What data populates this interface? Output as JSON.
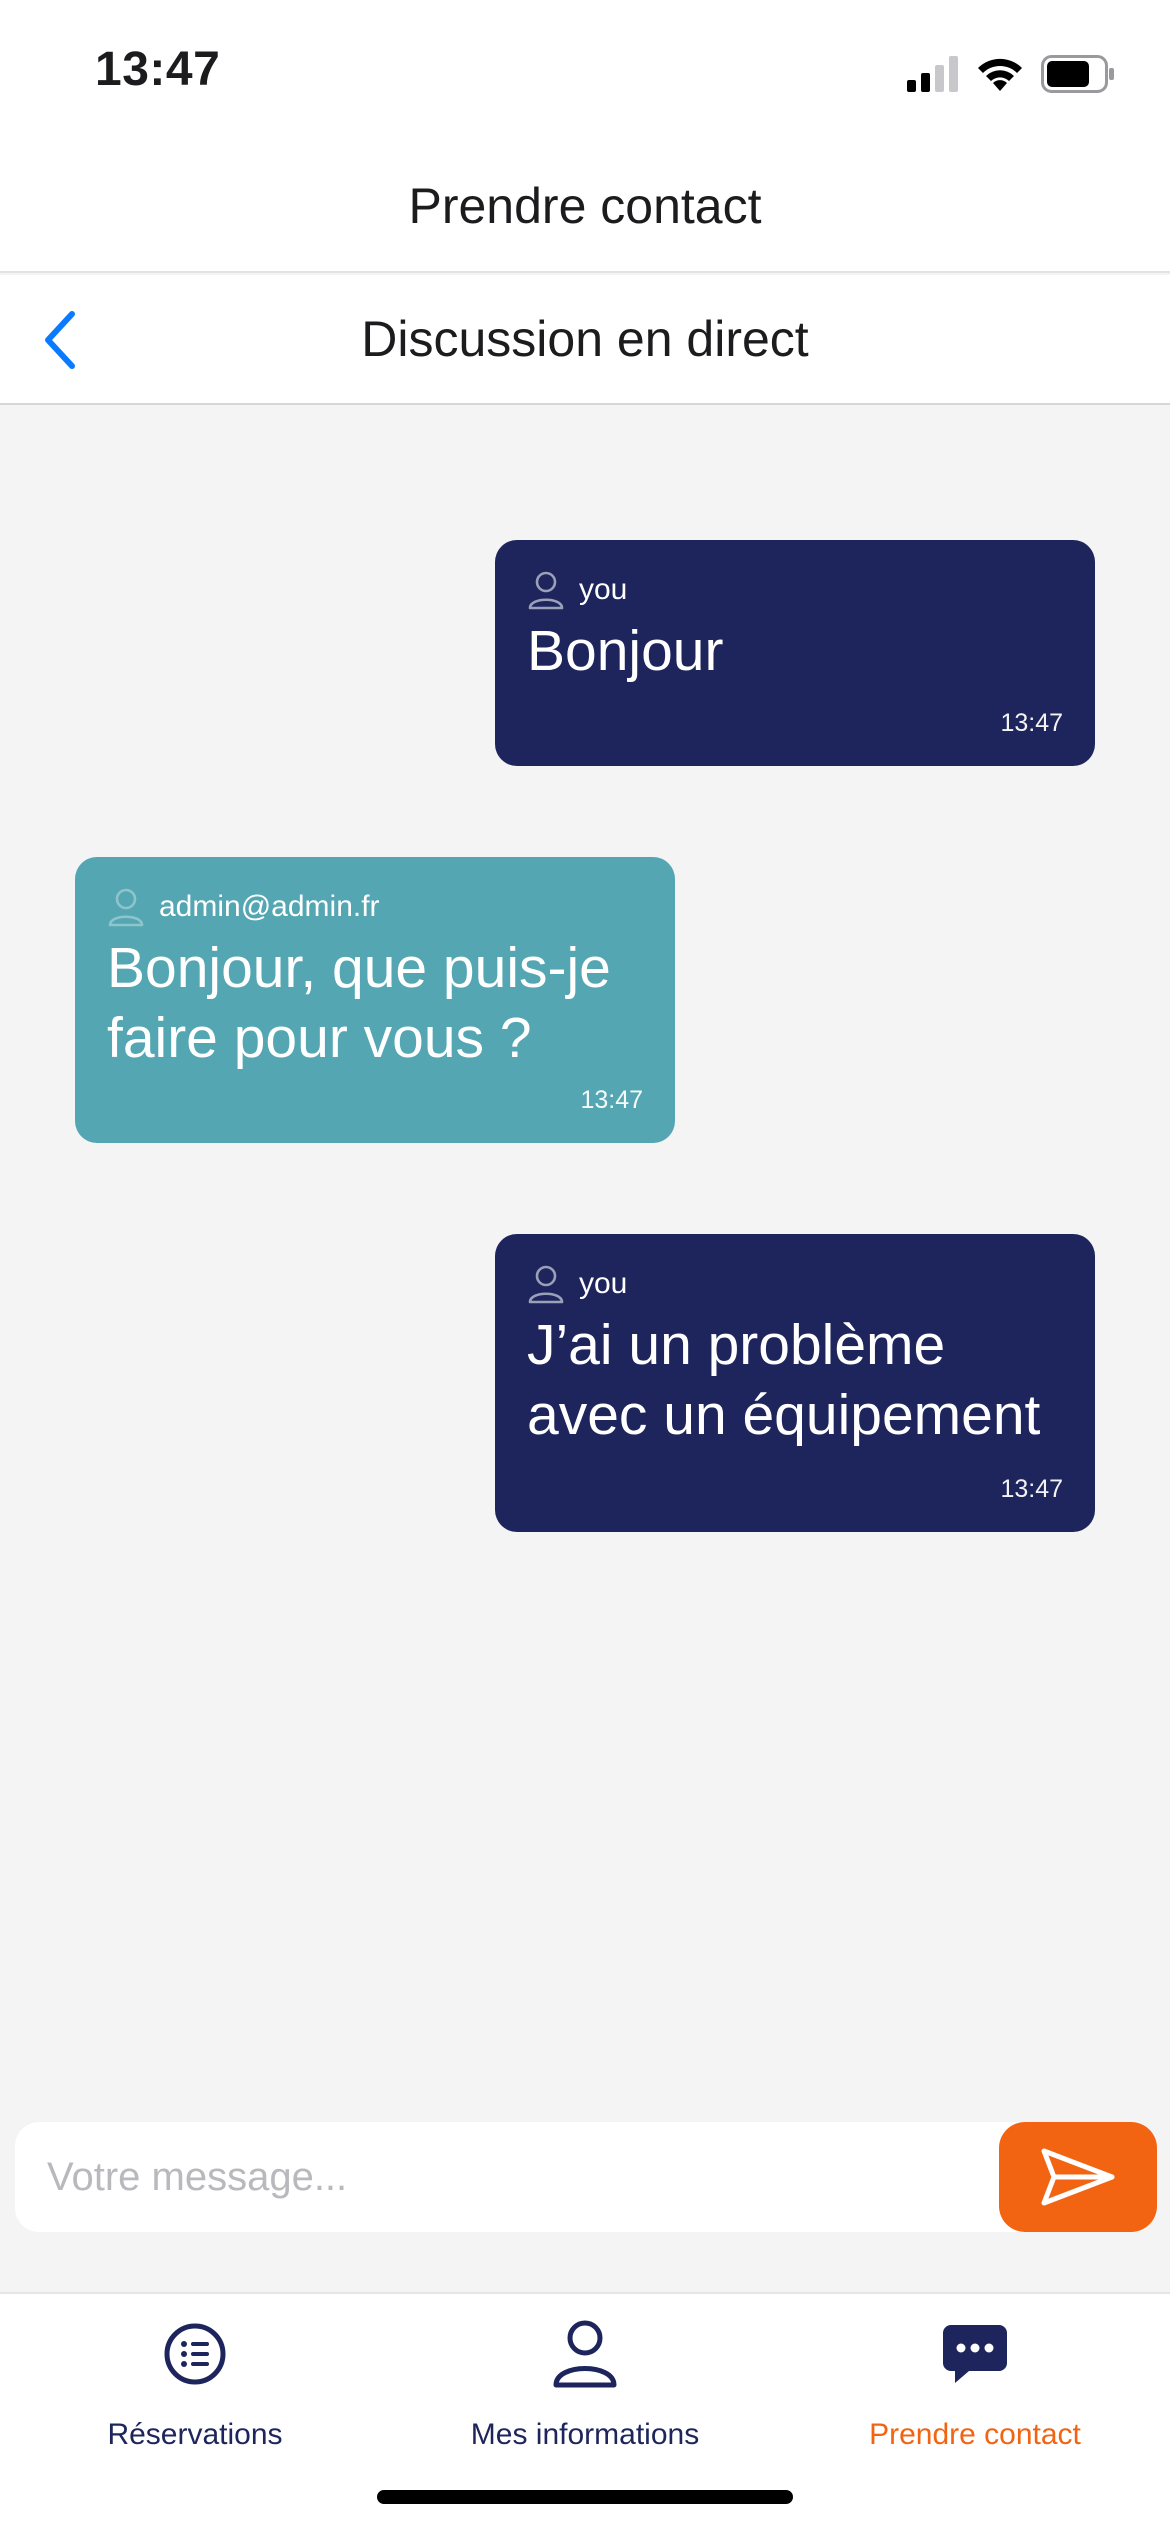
{
  "status_bar": {
    "time": "13:47"
  },
  "header": {
    "title": "Prendre contact"
  },
  "sub_header": {
    "title": "Discussion en direct"
  },
  "messages": [
    {
      "sender": "you",
      "text": "Bonjour",
      "time": "13:47"
    },
    {
      "sender": "admin@admin.fr",
      "text": "Bonjour, que puis-je faire pour vous ?",
      "time": "13:47"
    },
    {
      "sender": "you",
      "text": "J’ai un problème avec un équipement",
      "time": "13:47"
    }
  ],
  "composer": {
    "placeholder": "Votre message..."
  },
  "tabs": [
    {
      "label": "Réservations",
      "icon": "list-icon"
    },
    {
      "label": "Mes informations",
      "icon": "person-icon"
    },
    {
      "label": "Prendre contact",
      "icon": "chat-bubble-icon",
      "active": true
    }
  ],
  "colors": {
    "navy": "#1d255c",
    "teal": "#53a6b2",
    "orange": "#f26411",
    "ios_blue": "#0a7aff"
  }
}
